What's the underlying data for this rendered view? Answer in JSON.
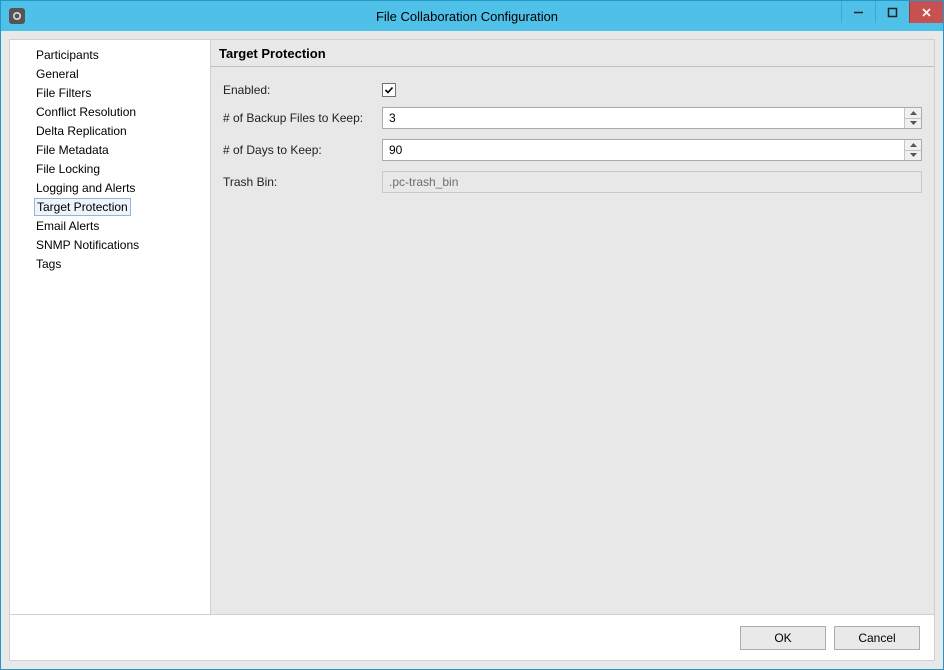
{
  "window": {
    "title": "File Collaboration Configuration"
  },
  "sidebar": {
    "items": [
      {
        "label": "Participants"
      },
      {
        "label": "General"
      },
      {
        "label": "File Filters"
      },
      {
        "label": "Conflict Resolution"
      },
      {
        "label": "Delta Replication"
      },
      {
        "label": "File Metadata"
      },
      {
        "label": "File Locking"
      },
      {
        "label": "Logging and Alerts"
      },
      {
        "label": "Target Protection"
      },
      {
        "label": "Email Alerts"
      },
      {
        "label": "SNMP Notifications"
      },
      {
        "label": "Tags"
      }
    ],
    "selected_index": 8
  },
  "panel": {
    "title": "Target Protection",
    "enabled_label": "Enabled:",
    "enabled_checked": true,
    "backup_label": "# of Backup Files to Keep:",
    "backup_value": "3",
    "days_label": "# of Days to Keep:",
    "days_value": "90",
    "trash_label": "Trash Bin:",
    "trash_value": ".pc-trash_bin"
  },
  "footer": {
    "ok": "OK",
    "cancel": "Cancel"
  }
}
